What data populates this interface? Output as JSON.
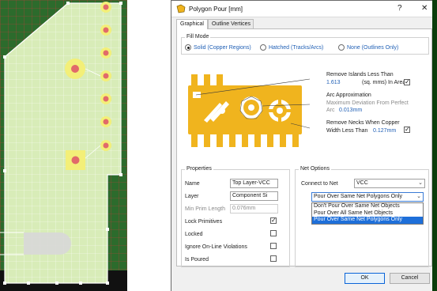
{
  "dialog": {
    "title": "Polygon Pour [mm]",
    "help_glyph": "?",
    "close_glyph": "✕",
    "tabs": [
      {
        "label": "Graphical",
        "active": true
      },
      {
        "label": "Outline Vertices",
        "active": false
      }
    ]
  },
  "fill_mode": {
    "legend": "Fill Mode",
    "options": [
      {
        "label": "Solid (Copper Regions)",
        "selected": true
      },
      {
        "label": "Hatched (Tracks/Arcs)",
        "selected": false
      },
      {
        "label": "None (Outlines Only)",
        "selected": false
      }
    ]
  },
  "diagram": {
    "islands": {
      "label_line1": "Remove Islands Less Than",
      "value": "1.613",
      "unit": "(sq. mms) In Area",
      "checked": true
    },
    "arc": {
      "title": "Arc Approximation",
      "desc_line1": "Maximum Deviation From Perfect",
      "desc_line2_prefix": "Arc",
      "value": "0.013mm"
    },
    "necks": {
      "label_line1": "Remove Necks When Copper",
      "label_line2_prefix": "Width Less Than",
      "value": "0.127mm",
      "checked": true
    }
  },
  "properties": {
    "legend": "Properties",
    "name_label": "Name",
    "name_value": "Top Layer-VCC",
    "layer_label": "Layer",
    "layer_value": "Component Si",
    "min_prim_label": "Min Prim Length",
    "min_prim_value": "0.076mm",
    "checkboxes": [
      {
        "label": "Lock Primitives",
        "checked": true
      },
      {
        "label": "Locked",
        "checked": false
      },
      {
        "label": "Ignore On-Line Violations",
        "checked": false
      },
      {
        "label": "Is Poured",
        "checked": false
      }
    ]
  },
  "net_options": {
    "legend": "Net Options",
    "connect_label": "Connect to Net",
    "connect_value": "VCC",
    "pour_value": "Pour Over Same Net Polygons Only",
    "dropdown_items": [
      {
        "label": "Don't Pour Over Same Net Objects",
        "selected": false
      },
      {
        "label": "Pour Over All Same Net Objects",
        "selected": false
      },
      {
        "label": "Pour Over Same Net Polygons Only",
        "selected": true
      }
    ]
  },
  "buttons": {
    "ok": "OK",
    "cancel": "Cancel"
  },
  "colors": {
    "copper": "#f0b41e",
    "pcb_background": "#101010",
    "pcb_green": "#2d6a2d",
    "polygon_fill": "#d7ecb6",
    "pad_ring": "#f5f07a",
    "pad_hole": "#e26a6a",
    "accent_blue": "#1f5fb5",
    "selection": "#1e6fd9"
  },
  "icons": {
    "polygon": "polygon-pour-icon",
    "dropdown": "chevron-down-icon",
    "check": "checkmark-icon"
  }
}
